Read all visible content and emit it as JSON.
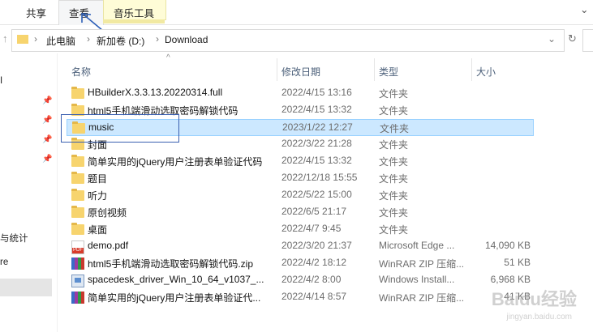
{
  "ribbon": {
    "tabs": [
      {
        "label": "共享"
      },
      {
        "label": "查看"
      },
      {
        "label": "音乐工具"
      }
    ]
  },
  "address": {
    "crumbs": [
      "此电脑",
      "新加卷 (D:)",
      "Download"
    ]
  },
  "sidebar": {
    "partial_items": [
      "I",
      "与统计",
      "re"
    ]
  },
  "columns": {
    "name": "名称",
    "date": "修改日期",
    "type": "类型",
    "size": "大小"
  },
  "files": [
    {
      "icon": "folder-icon",
      "name": "HBuilderX.3.3.13.20220314.full",
      "date": "2022/4/15 13:16",
      "type": "文件夹",
      "size": ""
    },
    {
      "icon": "folder-icon",
      "name": "html5手机端滑动选取密码解锁代码",
      "date": "2022/4/15 13:32",
      "type": "文件夹",
      "size": ""
    },
    {
      "icon": "folder-icon",
      "name": "music",
      "date": "2023/1/22 12:27",
      "type": "文件夹",
      "size": "",
      "selected": true
    },
    {
      "icon": "folder-icon",
      "name": "封面",
      "date": "2022/3/22 21:28",
      "type": "文件夹",
      "size": ""
    },
    {
      "icon": "folder-icon",
      "name": "简单实用的jQuery用户注册表单验证代码",
      "date": "2022/4/15 13:32",
      "type": "文件夹",
      "size": ""
    },
    {
      "icon": "folder-icon",
      "name": "题目",
      "date": "2022/12/18 15:55",
      "type": "文件夹",
      "size": ""
    },
    {
      "icon": "folder-icon",
      "name": "听力",
      "date": "2022/5/22 15:00",
      "type": "文件夹",
      "size": ""
    },
    {
      "icon": "folder-icon",
      "name": "原创视频",
      "date": "2022/6/5 21:17",
      "type": "文件夹",
      "size": ""
    },
    {
      "icon": "folder-icon",
      "name": "桌面",
      "date": "2022/4/7 9:45",
      "type": "文件夹",
      "size": ""
    },
    {
      "icon": "pdf-icon",
      "name": "demo.pdf",
      "date": "2022/3/20 21:37",
      "type": "Microsoft Edge ...",
      "size": "14,090 KB"
    },
    {
      "icon": "zip-icon",
      "name": "html5手机端滑动选取密码解锁代码.zip",
      "date": "2022/4/2 18:12",
      "type": "WinRAR ZIP 压缩...",
      "size": "51 KB"
    },
    {
      "icon": "installer-icon",
      "name": "spacedesk_driver_Win_10_64_v1037_...",
      "date": "2022/4/2 8:00",
      "type": "Windows Install...",
      "size": "6,968 KB"
    },
    {
      "icon": "zip-icon",
      "name": "简单实用的jQuery用户注册表单验证代...",
      "date": "2022/4/14 8:57",
      "type": "WinRAR ZIP 压缩...",
      "size": "41 KB"
    }
  ],
  "watermark": {
    "text": "Baidu经验",
    "sub": "jingyan.baidu.com"
  }
}
